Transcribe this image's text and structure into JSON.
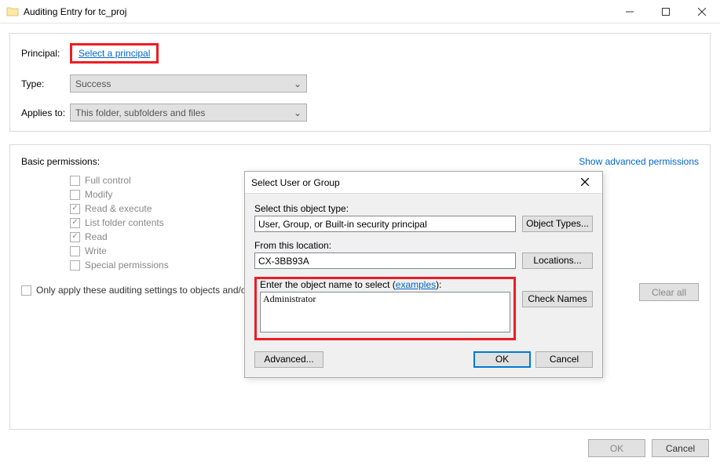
{
  "window": {
    "title": "Auditing Entry for tc_proj",
    "buttons": {
      "ok": "OK",
      "cancel": "Cancel"
    }
  },
  "principal": {
    "label": "Principal:",
    "link": "Select a principal"
  },
  "type": {
    "label": "Type:",
    "value": "Success"
  },
  "applies": {
    "label": "Applies to:",
    "value": "This folder, subfolders and files"
  },
  "permissions": {
    "title": "Basic permissions:",
    "advanced_link": "Show advanced permissions",
    "items": [
      {
        "label": "Full control",
        "checked": false
      },
      {
        "label": "Modify",
        "checked": false
      },
      {
        "label": "Read & execute",
        "checked": true
      },
      {
        "label": "List folder contents",
        "checked": true
      },
      {
        "label": "Read",
        "checked": true
      },
      {
        "label": "Write",
        "checked": false
      },
      {
        "label": "Special permissions",
        "checked": false
      }
    ],
    "only_apply": "Only apply these auditing settings to objects and/or",
    "clear": "Clear all"
  },
  "modal": {
    "title": "Select User or Group",
    "object_type_label": "Select this object type:",
    "object_type_value": "User, Group, or Built-in security principal",
    "object_types_btn": "Object Types...",
    "location_label": "From this location:",
    "location_value": "CX-3BB93A",
    "locations_btn": "Locations...",
    "enter_name_label": "Enter the object name to select",
    "examples": "examples",
    "name_value": "Administrator",
    "check_names": "Check Names",
    "advanced": "Advanced...",
    "ok": "OK",
    "cancel": "Cancel"
  }
}
